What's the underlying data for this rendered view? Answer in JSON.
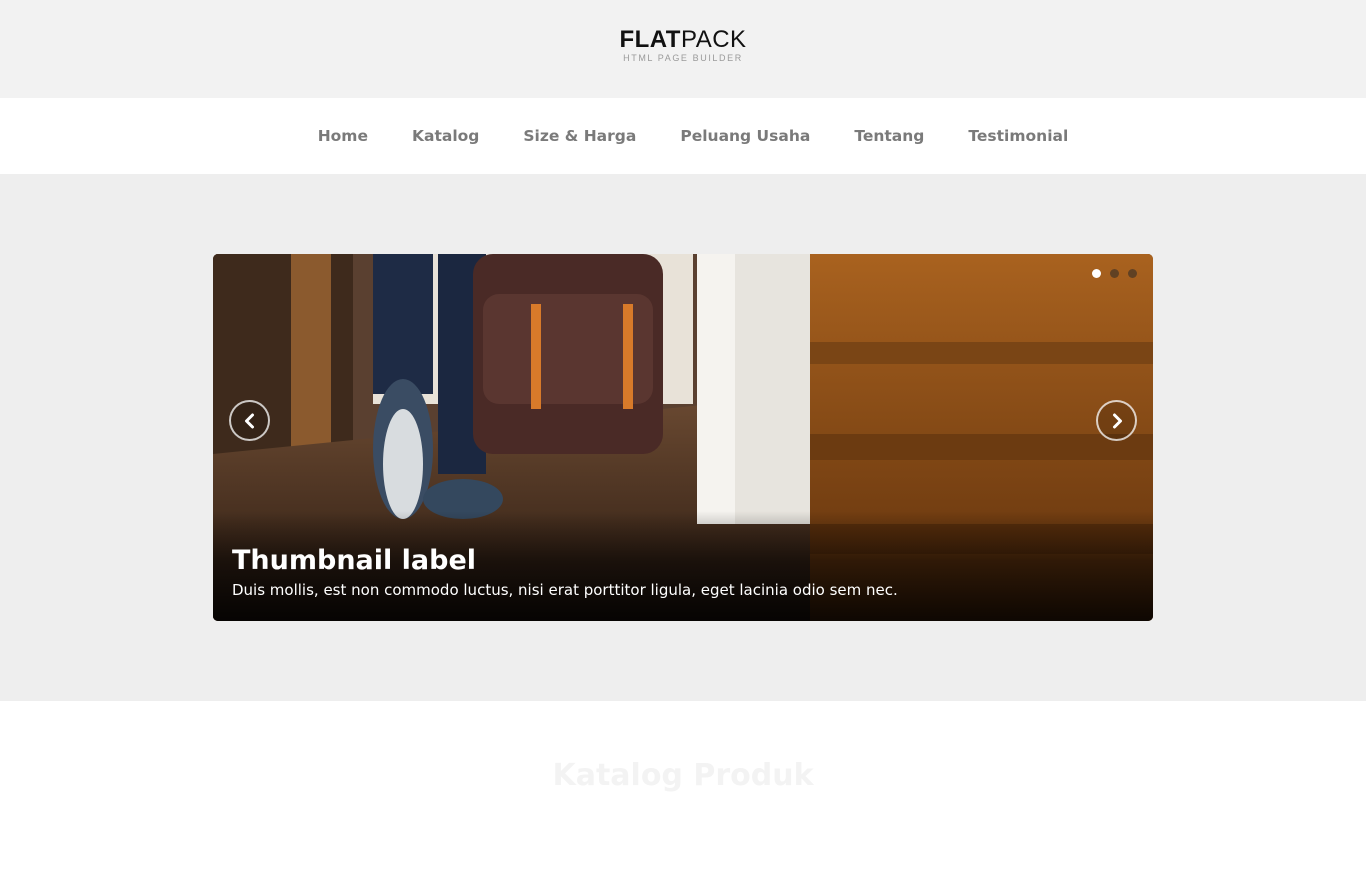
{
  "logo": {
    "bold": "FLAT",
    "light": "PACK",
    "tagline": "HTML PAGE BUILDER"
  },
  "nav": {
    "items": [
      "Home",
      "Katalog",
      "Size & Harga",
      "Peluang Usaha",
      "Tentang",
      "Testimonial"
    ]
  },
  "slider": {
    "caption_title": "Thumbnail label",
    "caption_text": "Duis mollis, est non commodo luctus, nisi erat porttitor ligula, eget lacinia odio sem nec.",
    "slide_count": 3,
    "active_slide": 1,
    "prev_icon": "chevron-left-icon",
    "next_icon": "chevron-right-icon"
  },
  "catalog": {
    "title": "Katalog Produk",
    "line1": "",
    "line2": ""
  },
  "colors": {
    "topbar_bg": "#f2f2f2",
    "hero_bg": "#eeeeee",
    "nav_text": "#7a7a7a"
  }
}
